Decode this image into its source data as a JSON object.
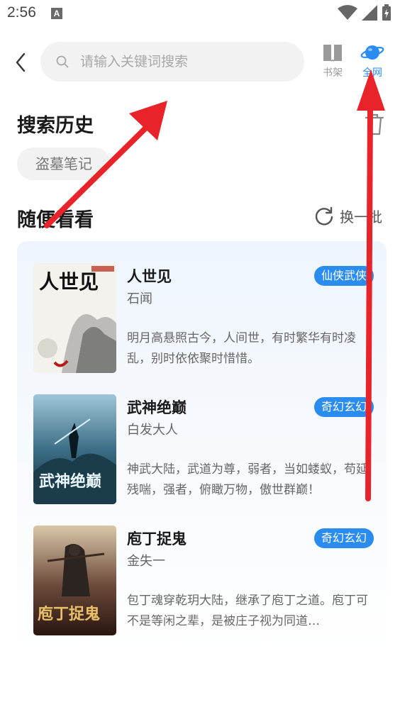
{
  "status": {
    "time": "2:56",
    "notif_letter": "A"
  },
  "search": {
    "placeholder": "请输入关键词搜索"
  },
  "tabs": [
    {
      "label": "书架",
      "icon": "book-icon"
    },
    {
      "label": "全网",
      "icon": "planet-icon"
    }
  ],
  "history": {
    "title": "搜索历史",
    "items": [
      "盗墓笔记"
    ]
  },
  "browse": {
    "title": "随便看看",
    "refresh_label": "换一批"
  },
  "books": [
    {
      "title": "人世见",
      "author": "石闻",
      "tag": "仙侠武侠",
      "desc": "明月高悬照古今，人间世，有时繁华有时凌乱，别时依依聚时惜惜。",
      "cover_text": "人世见"
    },
    {
      "title": "武神绝巅",
      "author": "白发大人",
      "tag": "奇幻玄幻",
      "desc": "神武大陆，武道为尊，弱者，当如蝼蚁，苟延残喘，强者，俯瞰万物，傲世群巅！",
      "cover_text": "武神绝巅"
    },
    {
      "title": "庖丁捉鬼",
      "author": "金失一",
      "tag": "奇幻玄幻",
      "desc": "包丁魂穿乾玥大陆，继承了庖丁之道。庖丁可不是等闲之辈，是被庄子视为同道…",
      "cover_text": "庖丁捉鬼"
    }
  ],
  "colors": {
    "accent": "#2b8cf0",
    "annotation": "#e8232a"
  }
}
